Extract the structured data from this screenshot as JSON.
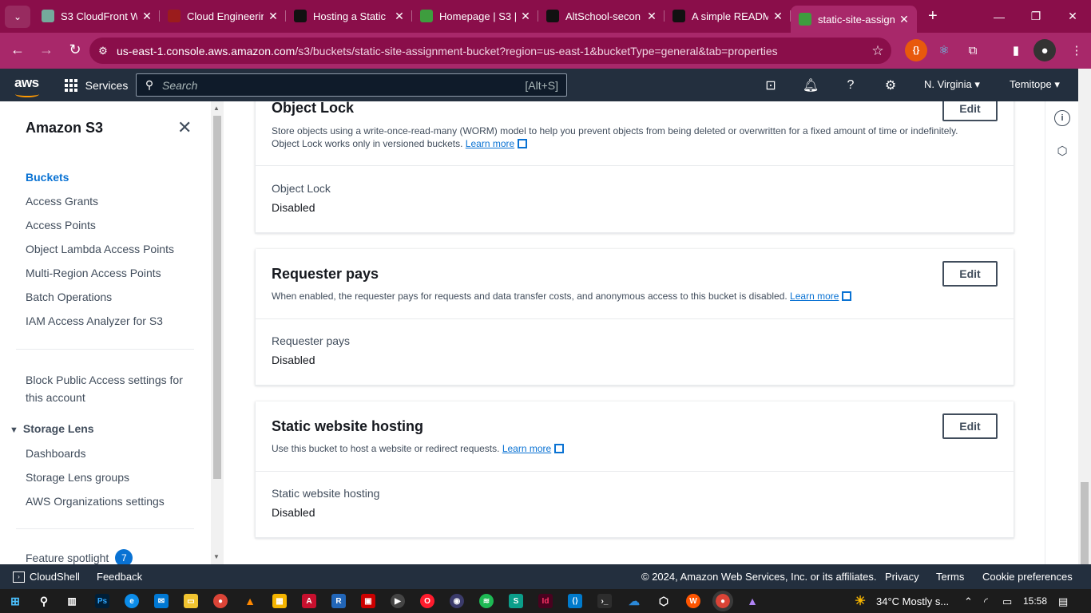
{
  "browser": {
    "tabs": [
      {
        "title": "S3 CloudFront W",
        "favicon_color": "#74aa9c"
      },
      {
        "title": "Cloud Engineerin",
        "favicon_color": "#9b1c1c"
      },
      {
        "title": "Hosting a Static",
        "favicon_color": "#111111"
      },
      {
        "title": "Homepage | S3 |",
        "favicon_color": "#3e9d3e"
      },
      {
        "title": "AltSchool-secon",
        "favicon_color": "#111111"
      },
      {
        "title": "A simple READM",
        "favicon_color": "#111111"
      },
      {
        "title": "static-site-assign",
        "favicon_color": "#3e9d3e"
      }
    ],
    "url_host": "us-east-1.console.aws.amazon.com",
    "url_path": "/s3/buckets/static-site-assignment-bucket?region=us-east-1&bucketType=general&tab=properties"
  },
  "aws_nav": {
    "logo": "aws",
    "services_label": "Services",
    "search_placeholder": "Search",
    "search_shortcut": "[Alt+S]",
    "region": "N. Virginia ▾",
    "user": "Temitope ▾"
  },
  "sidebar": {
    "title": "Amazon S3",
    "items": [
      "Buckets",
      "Access Grants",
      "Access Points",
      "Object Lambda Access Points",
      "Multi-Region Access Points",
      "Batch Operations",
      "IAM Access Analyzer for S3"
    ],
    "block_public_line1": "Block Public Access settings for",
    "block_public_line2": "this account",
    "storage_lens_header": "Storage Lens",
    "storage_lens_items": [
      "Dashboards",
      "Storage Lens groups",
      "AWS Organizations settings"
    ],
    "feature_spotlight": "Feature spotlight",
    "feature_spotlight_count": "7"
  },
  "cards": {
    "object_lock": {
      "title": "Object Lock",
      "desc_line1": "Store objects using a write-once-read-many (WORM) model to help you prevent objects from being deleted or overwritten for a fixed amount of time or indefinitely.",
      "desc_line2": "Object Lock works only in versioned buckets.",
      "learn_more": "Learn more",
      "edit": "Edit",
      "key": "Object Lock",
      "value": "Disabled"
    },
    "requester_pays": {
      "title": "Requester pays",
      "desc": "When enabled, the requester pays for requests and data transfer costs, and anonymous access to this bucket is disabled.",
      "learn_more": "Learn more",
      "edit": "Edit",
      "key": "Requester pays",
      "value": "Disabled"
    },
    "static_hosting": {
      "title": "Static website hosting",
      "desc": "Use this bucket to host a website or redirect requests.",
      "learn_more": "Learn more",
      "edit": "Edit",
      "key": "Static website hosting",
      "value": "Disabled"
    }
  },
  "footer": {
    "cloudshell": "CloudShell",
    "feedback": "Feedback",
    "copyright": "© 2024, Amazon Web Services, Inc. or its affiliates.",
    "privacy": "Privacy",
    "terms": "Terms",
    "cookies": "Cookie preferences"
  },
  "taskbar": {
    "weather": "34°C  Mostly s...",
    "time": "15:58"
  }
}
